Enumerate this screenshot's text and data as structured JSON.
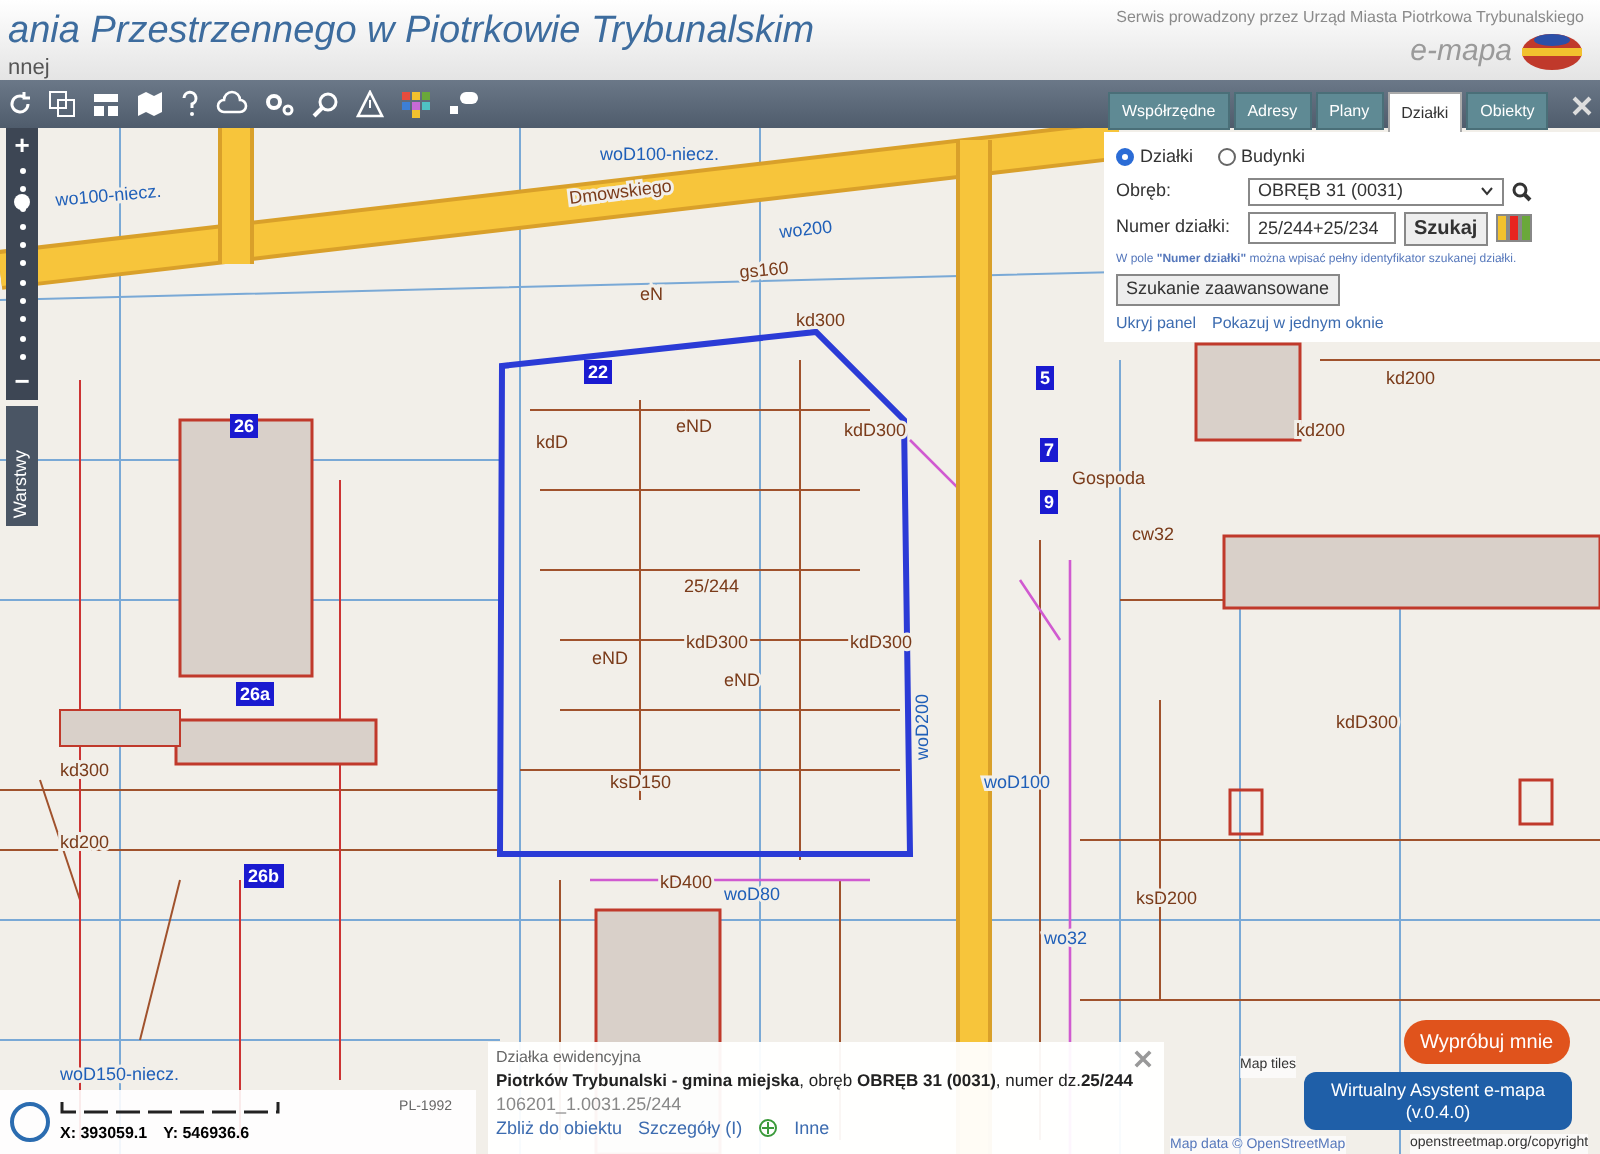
{
  "header": {
    "title": "ania Przestrzennego w Piotrkowie Trybunalskim",
    "subtitle": "nnej",
    "provider": "Serwis prowadzony przez Urząd Miasta Piotrkowa Trybunalskiego",
    "logo": "e-mapa"
  },
  "zoom": {
    "plus": "+",
    "minus": "−",
    "level": 0.85
  },
  "layers_tab": {
    "label": "Warstwy"
  },
  "panel": {
    "tabs": [
      {
        "label": "Współrzędne",
        "selected": false
      },
      {
        "label": "Adresy",
        "selected": false
      },
      {
        "label": "Plany",
        "selected": false
      },
      {
        "label": "Działki",
        "selected": true
      },
      {
        "label": "Obiekty",
        "selected": false
      }
    ],
    "modes": [
      {
        "label": "Działki",
        "selected": true
      },
      {
        "label": "Budynki",
        "selected": false
      }
    ],
    "precinct": {
      "label": "Obręb:",
      "value": "OBRĘB 31 (0031)"
    },
    "parcel": {
      "label": "Numer działki:",
      "value": "25/244+25/234"
    },
    "search_button": "Szukaj",
    "status_colors": [
      {
        "color": "#f2c12e"
      },
      {
        "color": "#e8251f"
      },
      {
        "color": "#6aa83a"
      }
    ],
    "hint": "W pole **\"Numer działki\"** można wpisać pełny identyfikator szukanej działki.",
    "advanced_button": "Szukanie zaawansowane",
    "links": [
      "Ukryj panel",
      "Pokazuj w jednym oknie"
    ]
  },
  "map": {
    "labels": [
      "woD100-niecz.",
      "Dmowskiego",
      "wo100-niecz.",
      "wo200",
      "gs160",
      "eN",
      "kd300",
      "eND",
      "kdD",
      "kdD300",
      "25/244",
      "kdD300",
      "kdD300",
      "eND",
      "eND",
      "ksD150",
      "kd300",
      "kd200",
      "kD400",
      "woD80",
      "ksD200",
      "kd200",
      "cw32",
      "kdD300",
      "woD100",
      "wo32",
      "Gospoda",
      "woD150-niecz.",
      "woD200",
      "kd200"
    ],
    "parcel_numbers": [
      "22",
      "26",
      "26a",
      "26b",
      "5",
      "7",
      "9"
    ]
  },
  "info": {
    "title": "Działka ewidencyjna",
    "description": "**Piotrków Trybunalski - gmina miejska**, obręb **OBRĘB 31 (0031)**, numer dz.**25/244**",
    "id": "106201_1.0031.25/244",
    "links": [
      "Zbliż do obiektu",
      "Szczegóły (I)",
      "Inne"
    ]
  },
  "assistant": {
    "prompt": "Wypróbuj mnie",
    "button": "Wirtualny Asystent e-mapa (v.0.4.0)"
  },
  "attribution": [
    "Map tiles",
    "Map data © OpenStreetMap",
    "openstreetmap.org/copyright"
  ],
  "status": {
    "crs": "PL-1992",
    "x": "X: 393059.1",
    "y": "Y: 546936.6"
  }
}
